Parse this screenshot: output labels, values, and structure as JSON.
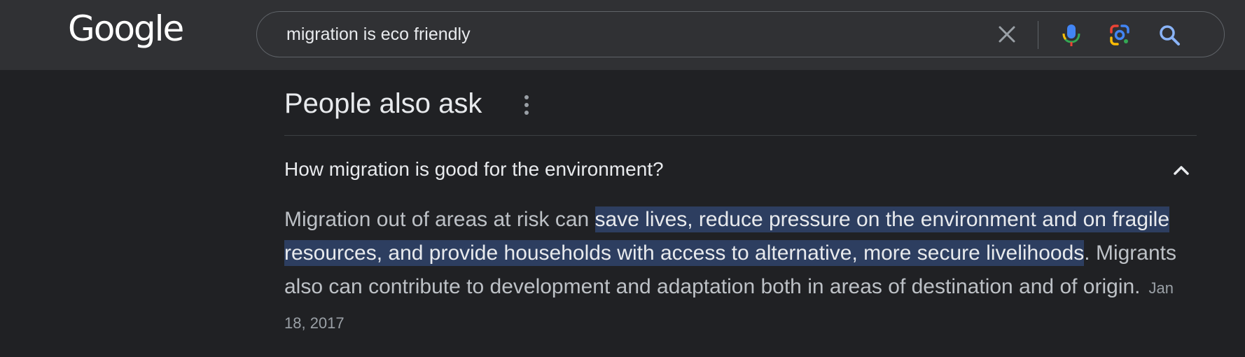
{
  "header": {
    "logo_text": "Google",
    "search": {
      "query": "migration is eco friendly",
      "clear_icon": "close-icon",
      "mic_icon": "microphone-icon",
      "lens_icon": "google-lens-icon",
      "search_icon": "search-icon"
    }
  },
  "people_also_ask": {
    "title": "People also ask",
    "menu_icon": "more-vertical-icon",
    "question": "How migration is good for the environment?",
    "expanded": true,
    "answer": {
      "before": "Migration out of areas at risk can ",
      "highlight": "save lives, reduce pressure on the environment and on fragile resources, and provide households with access to alternative, more secure livelihoods",
      "after": ". Migrants also can contribute to development and adaptation both in areas of destination and of origin.",
      "date": "Jan 18, 2017"
    }
  },
  "colors": {
    "page_bg": "#202124",
    "header_bg": "#303134",
    "highlight_bg": "#2d3e60",
    "text_primary": "#e8eaed",
    "text_secondary": "#bdc1c6"
  }
}
